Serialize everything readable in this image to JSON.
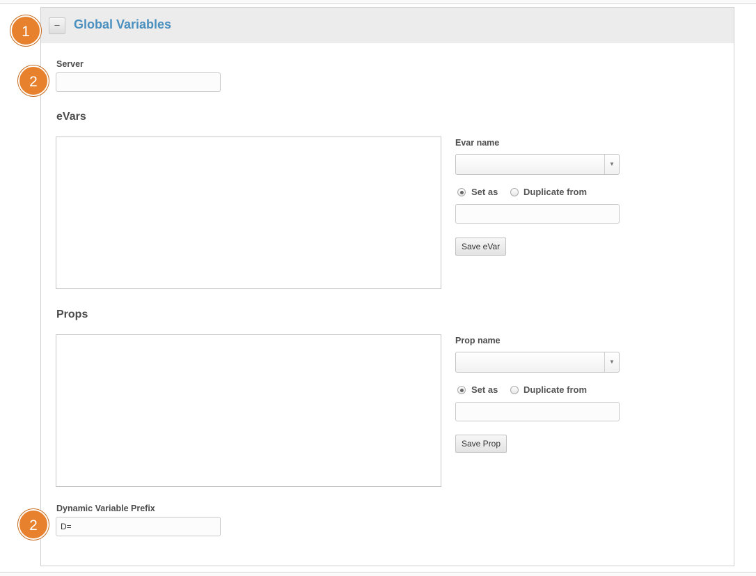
{
  "panel": {
    "title": "Global Variables",
    "collapse_label": "–"
  },
  "callouts": [
    "1",
    "2",
    "2"
  ],
  "server": {
    "label": "Server",
    "value": ""
  },
  "evars": {
    "section_title": "eVars",
    "name_label": "Evar name",
    "radio_set_as": "Set as",
    "radio_duplicate": "Duplicate from",
    "selected_radio": "Set as",
    "value": "",
    "save_label": "Save eVar"
  },
  "props": {
    "section_title": "Props",
    "name_label": "Prop name",
    "radio_set_as": "Set as",
    "radio_duplicate": "Duplicate from",
    "selected_radio": "Set as",
    "value": "",
    "save_label": "Save Prop"
  },
  "dynamic_prefix": {
    "label": "Dynamic Variable Prefix",
    "value": "D="
  },
  "colors": {
    "title": "#4a90bf",
    "callout": "#e7812d",
    "header_bg": "#ececec"
  }
}
